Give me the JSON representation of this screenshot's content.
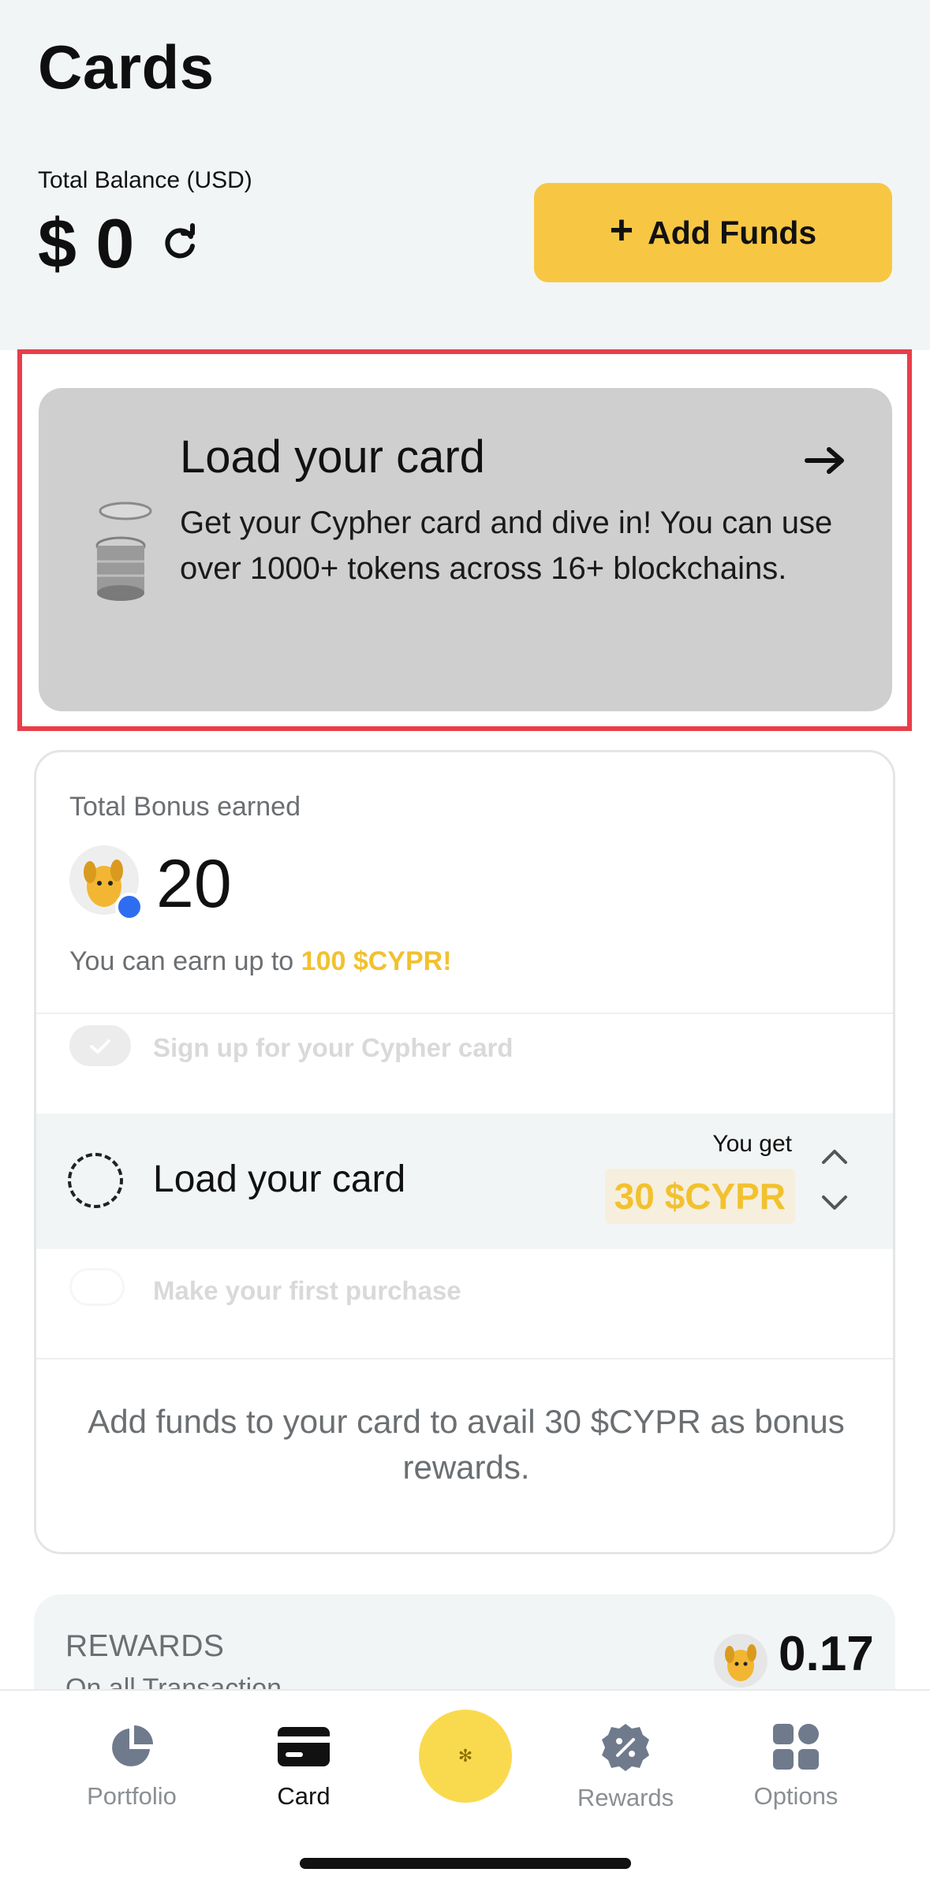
{
  "header": {
    "title": "Cards",
    "balance_label": "Total Balance (USD)",
    "balance_value": "$ 0",
    "add_funds_label": "Add Funds"
  },
  "load_card_banner": {
    "title": "Load your card",
    "description": "Get your Cypher card and dive in! You can use over 1000+ tokens across 16+ blockchains."
  },
  "bonus": {
    "label": "Total Bonus earned",
    "value": "20",
    "earn_prefix": "You can earn up to ",
    "earn_highlight": "100 $CYPR!",
    "tasks": [
      {
        "label": "Sign up for your Cypher card",
        "state": "done"
      },
      {
        "label": "Load your card",
        "state": "active",
        "you_get": "You get",
        "reward": "30 $CYPR"
      },
      {
        "label": "Make your first purchase",
        "state": "pending"
      }
    ],
    "info": "Add funds to your card to avail 30 $CYPR as bonus rewards."
  },
  "rewards": {
    "title": "REWARDS",
    "subtitle": "On all Transaction",
    "value": "0.17"
  },
  "tabbar": {
    "items": [
      {
        "label": "Portfolio",
        "icon": "pie-chart-icon"
      },
      {
        "label": "Card",
        "icon": "card-icon",
        "active": true
      },
      {
        "label": "Rewards",
        "icon": "percent-badge-icon"
      },
      {
        "label": "Options",
        "icon": "grid-icon"
      }
    ],
    "center_icon": "sparkle-icon"
  },
  "colors": {
    "accent_yellow": "#f7c744",
    "highlight_red": "#e83e4a",
    "muted_text": "#6b6f72"
  }
}
